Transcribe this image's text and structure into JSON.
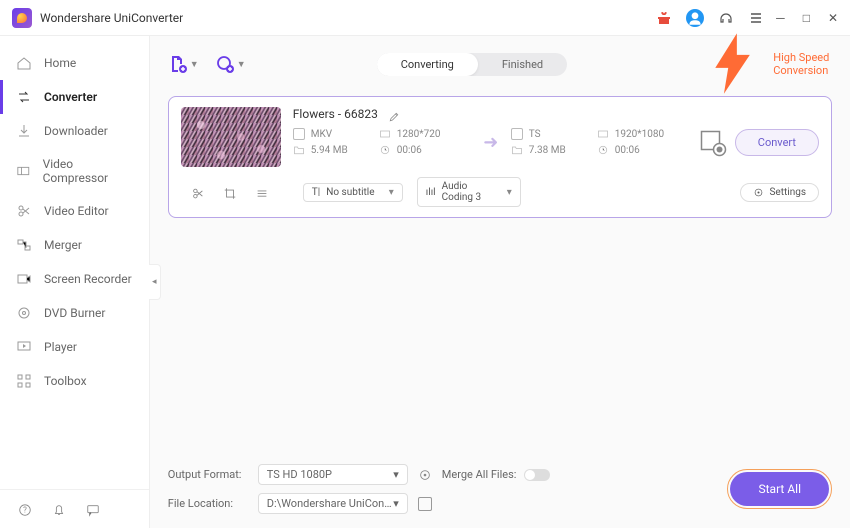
{
  "app": {
    "title": "Wondershare UniConverter"
  },
  "sidebar": {
    "items": [
      {
        "label": "Home",
        "icon": "home"
      },
      {
        "label": "Converter",
        "icon": "converter",
        "active": true
      },
      {
        "label": "Downloader",
        "icon": "download"
      },
      {
        "label": "Video Compressor",
        "icon": "compress"
      },
      {
        "label": "Video Editor",
        "icon": "scissors"
      },
      {
        "label": "Merger",
        "icon": "merge"
      },
      {
        "label": "Screen Recorder",
        "icon": "record"
      },
      {
        "label": "DVD Burner",
        "icon": "dvd"
      },
      {
        "label": "Player",
        "icon": "play"
      },
      {
        "label": "Toolbox",
        "icon": "grid"
      }
    ]
  },
  "tabs": {
    "converting": "Converting",
    "finished": "Finished"
  },
  "hsc_label": "High Speed Conversion",
  "file": {
    "title": "Flowers - 66823",
    "src": {
      "format": "MKV",
      "res": "1280*720",
      "size": "5.94 MB",
      "dur": "00:06"
    },
    "dst": {
      "format": "TS",
      "res": "1920*1080",
      "size": "7.38 MB",
      "dur": "00:06"
    },
    "convert_btn": "Convert",
    "subtitle": "No subtitle",
    "audio": "Audio Coding 3",
    "settings": "Settings"
  },
  "footer": {
    "output_format_label": "Output Format:",
    "output_format_value": "TS HD 1080P",
    "file_location_label": "File Location:",
    "file_location_value": "D:\\Wondershare UniConverter",
    "merge_label": "Merge All Files:",
    "start_all": "Start All"
  }
}
